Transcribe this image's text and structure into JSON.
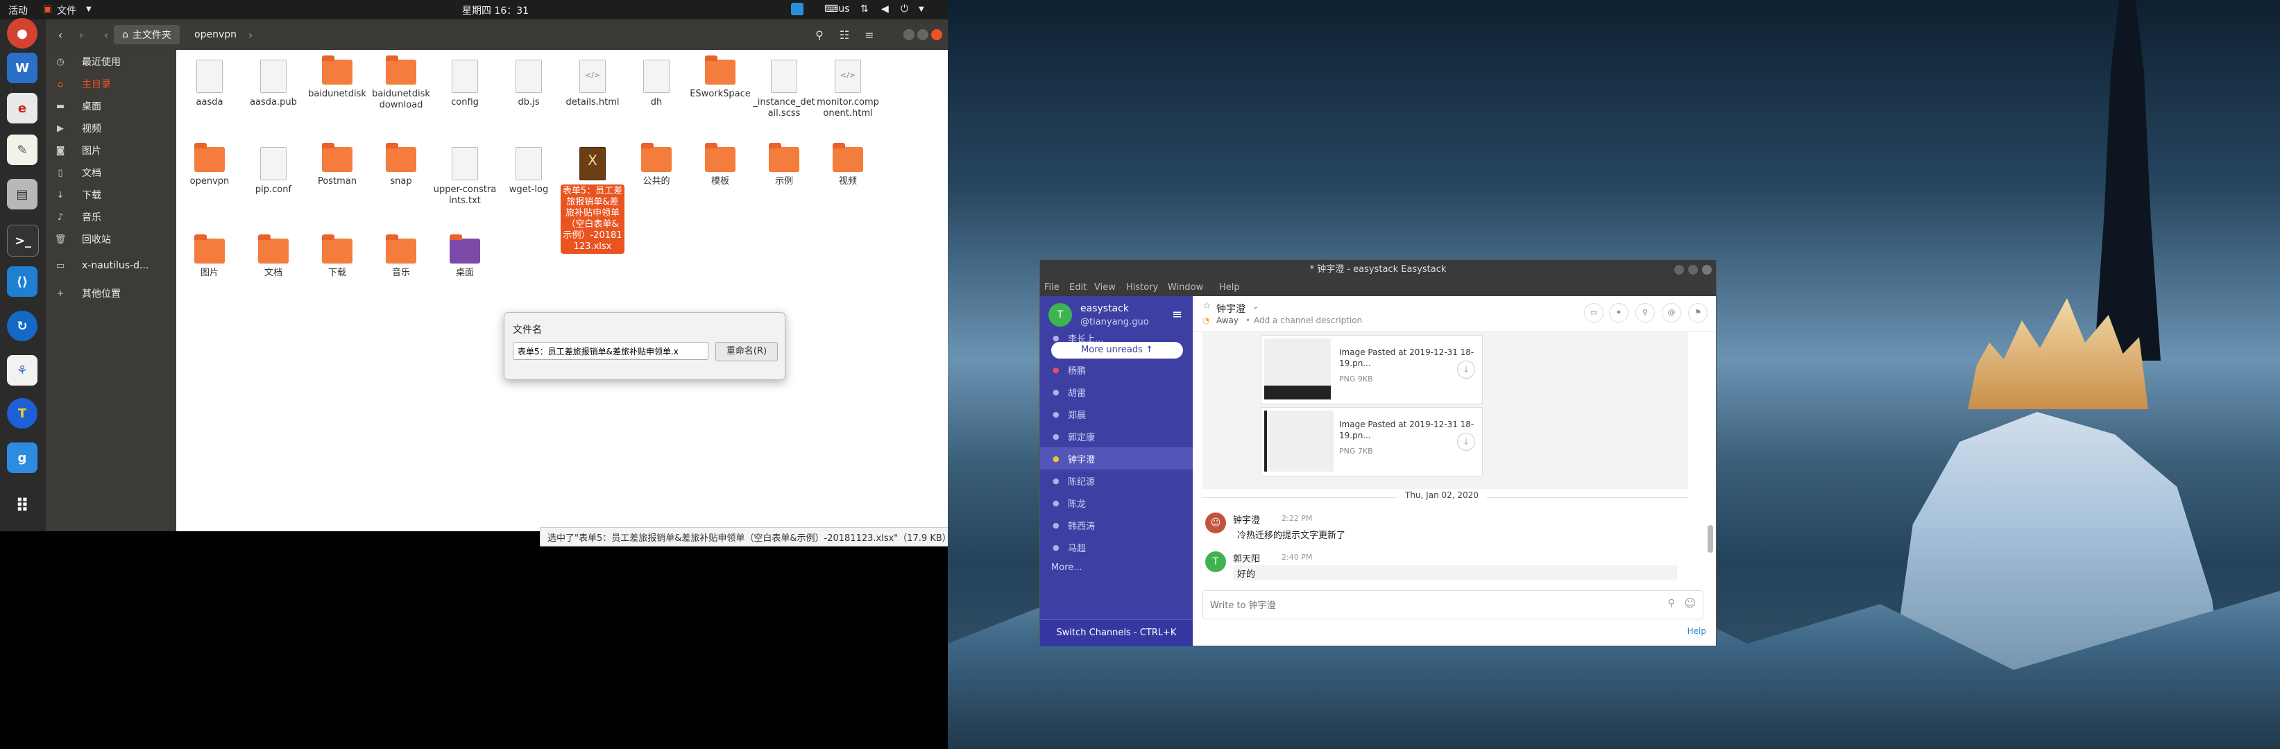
{
  "topbar": {
    "activities": "活动",
    "app_menu": "文件",
    "clock": "星期四 16：31",
    "input_method": "us"
  },
  "dock": {
    "apps": [
      "chrome-icon",
      "libreoffice-writer-icon",
      "pdf-viewer-icon",
      "text-editor-icon",
      "file-manager-icon",
      "terminal-icon",
      "vscode-icon",
      "update-icon",
      "network-icon",
      "teamviewer-icon",
      "mail-icon",
      "show-apps-icon"
    ]
  },
  "file_manager": {
    "breadcrumb_home": "主文件夹",
    "breadcrumb_current": "openvpn",
    "sidebar": [
      "最近使用",
      "主目录",
      "桌面",
      "视频",
      "图片",
      "文档",
      "下载",
      "音乐",
      "回收站",
      "x-nautilus-d...",
      "其他位置"
    ],
    "files_row1": [
      "aasda",
      "aasda.pub",
      "baidunetdisk",
      "baidunetdiskdownload",
      "config",
      "db.js",
      "details.html",
      "dh",
      "ESworkSpace",
      "_instance_detail.scss",
      "monitor.component.html"
    ],
    "files_row2": [
      "openvpn",
      "pip.conf",
      "Postman",
      "snap",
      "upper-constraints.txt",
      "wget-log",
      "表单5：员工差旅报销单&差旅补贴申领单（空白表单&示例）-20181123.xlsx",
      "公共的",
      "模板",
      "示例",
      "视频"
    ],
    "files_row3": [
      "图片",
      "文档",
      "下载",
      "音乐",
      "桌面"
    ],
    "rename_popup": {
      "label": "文件名",
      "value": "表单5：员工差旅报销单&差旅补贴申领单.x",
      "button": "重命名(R)"
    },
    "status": "选中了\"表单5：员工差旅报销单&差旅补贴申领单（空白表单&示例）-20181123.xlsx\"（17.9 KB）"
  },
  "easystack": {
    "window_title": "* 钟宇澄 - easystack Easystack",
    "menu": [
      "File",
      "Edit",
      "View",
      "History",
      "Window",
      "Help"
    ],
    "team_name": "easystack",
    "username": "@tianyang.guo",
    "partial_channel": "李长上...",
    "more_unreads": "More unreads ↑",
    "channels": [
      "杨鹏",
      "胡雷",
      "郑晨",
      "郭定康",
      "钟宇澄",
      "陈纪源",
      "陈龙",
      "韩西涛",
      "马超"
    ],
    "more": "More...",
    "switch_channels": "Switch Channels - CTRL+K",
    "channel_header": {
      "name": "钟宇澄",
      "status": "Away",
      "description": "Add a channel description"
    },
    "attachments": [
      {
        "name": "Image Pasted at 2019-12-31 18-19.pn...",
        "meta": "PNG 9KB"
      },
      {
        "name": "Image Pasted at 2019-12-31 18-19.pn...",
        "meta": "PNG 7KB"
      }
    ],
    "date_separator": "Thu, Jan 02, 2020",
    "messages": [
      {
        "author": "钟宇澄",
        "time": "2:22 PM",
        "text": "冷热迁移的提示文字更新了"
      },
      {
        "author": "郭天阳",
        "time": "2:40 PM",
        "text": "好的"
      }
    ],
    "composer_placeholder": "Write to 钟宇澄",
    "help": "Help"
  }
}
